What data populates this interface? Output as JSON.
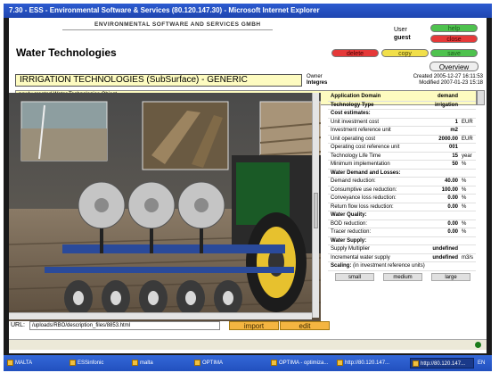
{
  "window": {
    "title": "7.30 - ESS - Environmental Software & Services (80.120.147.30) - Microsoft Internet Explorer"
  },
  "header": {
    "company": "ENVIRONMENTAL SOFTWARE AND SERVICES GMBH",
    "page_title": "Water Technologies",
    "user_label": "User",
    "user_value": "guest"
  },
  "buttons": {
    "help": "help",
    "close": "close",
    "delete": "delete",
    "copy": "copy",
    "save": "save",
    "overview": "Overview",
    "import": "import",
    "edit": "edit"
  },
  "object": {
    "name": "IRRIGATION TECHNOLOGIES (SubSurface) - GENERIC",
    "owner_label": "Owner",
    "owner_value": "Integres",
    "created": "Created 2005-12-27 16:11:53",
    "modified": "Modified 2007-01-23 15:18",
    "description": "newly created Water Technologies Object."
  },
  "url": {
    "label": "URL:",
    "value": "/uploads/RBO/description_files/8853.html"
  },
  "properties": [
    {
      "k": "Application Domain",
      "v": "demand",
      "u": "",
      "style": "bold"
    },
    {
      "k": "Technology Type",
      "v": "irrigation",
      "u": "",
      "style": "bold"
    },
    {
      "k": "Cost estimates:",
      "v": "",
      "u": "",
      "style": "section"
    },
    {
      "k": "Unit investment cost",
      "v": "1",
      "u": "EUR",
      "style": ""
    },
    {
      "k": "Investment reference unit",
      "v": "m2",
      "u": "",
      "style": ""
    },
    {
      "k": "Unit operating cost",
      "v": "2000.00",
      "u": "EUR",
      "style": ""
    },
    {
      "k": "Operating cost reference unit",
      "v": "001",
      "u": "",
      "style": ""
    },
    {
      "k": "Technology Life Time",
      "v": "15",
      "u": "year",
      "style": ""
    },
    {
      "k": "Minimum implementation",
      "v": "50",
      "u": "%",
      "style": ""
    },
    {
      "k": "Water Demand and Losses:",
      "v": "",
      "u": "",
      "style": "section"
    },
    {
      "k": "Demand reduction:",
      "v": "40.00",
      "u": "%",
      "style": ""
    },
    {
      "k": "Consumptive use reduction:",
      "v": "100.00",
      "u": "%",
      "style": ""
    },
    {
      "k": "Conveyance loss reduction:",
      "v": "0.00",
      "u": "%",
      "style": ""
    },
    {
      "k": "Return flow loss reduction:",
      "v": "0.00",
      "u": "%",
      "style": ""
    },
    {
      "k": "Water Quality:",
      "v": "",
      "u": "",
      "style": "section"
    },
    {
      "k": "BOD reduction:",
      "v": "0.00",
      "u": "%",
      "style": ""
    },
    {
      "k": "Tracer reduction:",
      "v": "0.00",
      "u": "%",
      "style": ""
    },
    {
      "k": "Water Supply:",
      "v": "",
      "u": "",
      "style": "section"
    },
    {
      "k": "Supply Multiplier",
      "v": "undefined",
      "u": "",
      "style": ""
    },
    {
      "k": "Incremental water supply",
      "v": "undefined",
      "u": "m3/s",
      "style": ""
    }
  ],
  "scaling": {
    "label": "Scaling:",
    "note": "(in investment reference units)",
    "options": [
      "small",
      "medium",
      "large"
    ]
  },
  "taskbar": [
    {
      "label": "MALTA",
      "active": false
    },
    {
      "label": "ESSinfonic",
      "active": false
    },
    {
      "label": "malta",
      "active": false
    },
    {
      "label": "OPTIMA",
      "active": false
    },
    {
      "label": "OPTIMA - optimiza...",
      "active": false
    },
    {
      "label": "http://80.120.147...",
      "active": false
    },
    {
      "label": "http://80.120.147...",
      "active": true
    },
    {
      "label": "EN",
      "active": false
    }
  ]
}
